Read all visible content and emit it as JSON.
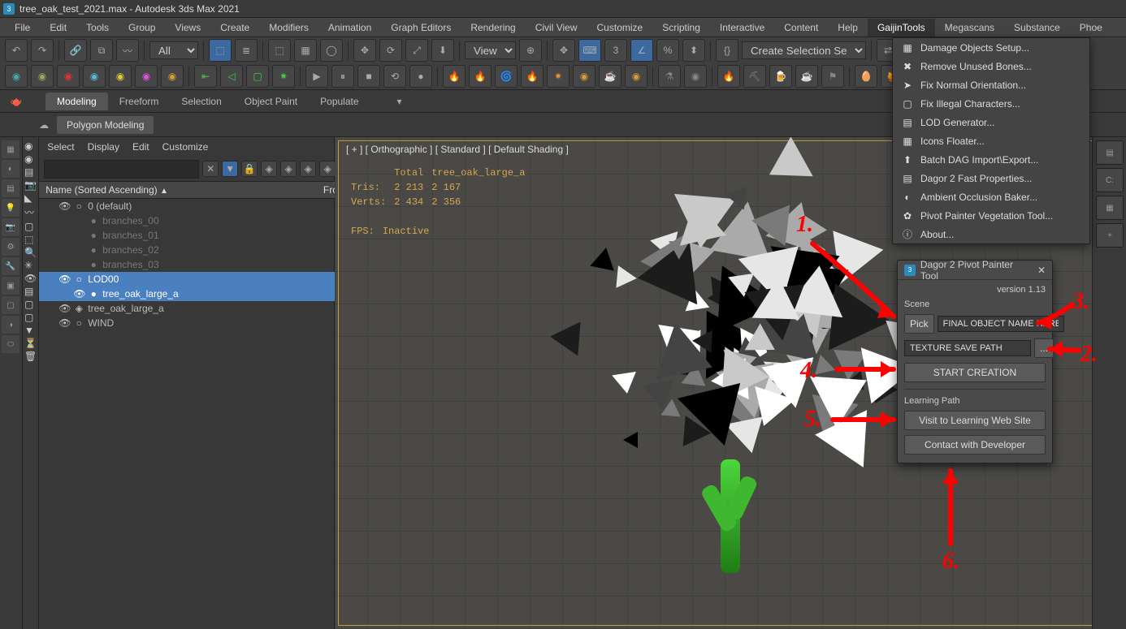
{
  "app": {
    "icon_label": "3",
    "title": "tree_oak_test_2021.max - Autodesk 3ds Max 2021"
  },
  "menu": [
    "File",
    "Edit",
    "Tools",
    "Group",
    "Views",
    "Create",
    "Modifiers",
    "Animation",
    "Graph Editors",
    "Rendering",
    "Civil View",
    "Customize",
    "Scripting",
    "Interactive",
    "Content",
    "Help",
    "GaijinTools",
    "Megascans",
    "Substance",
    "Phoe"
  ],
  "menu_active_index": 16,
  "toolbar": {
    "dd_all": "All",
    "dd_view": "View",
    "dd_selset": "Create Selection Se"
  },
  "ribbon": {
    "tabs": [
      "Modeling",
      "Freeform",
      "Selection",
      "Object Paint",
      "Populate"
    ],
    "active_index": 0,
    "sub_panel": "Polygon Modeling"
  },
  "explorer": {
    "menu": [
      "Select",
      "Display",
      "Edit",
      "Customize"
    ],
    "filter_placeholder": "",
    "header_name": "Name (Sorted Ascending)",
    "header_sort_arrow": "▲",
    "header_frozen": "Frozen",
    "rows": [
      {
        "indent": 0,
        "eye": "👁",
        "ico": "○",
        "text": "0 (default)",
        "ghost": false
      },
      {
        "indent": 1,
        "eye": "",
        "ico": "●",
        "text": "branches_00",
        "ghost": true
      },
      {
        "indent": 1,
        "eye": "",
        "ico": "●",
        "text": "branches_01",
        "ghost": true
      },
      {
        "indent": 1,
        "eye": "",
        "ico": "●",
        "text": "branches_02",
        "ghost": true
      },
      {
        "indent": 1,
        "eye": "",
        "ico": "●",
        "text": "branches_03",
        "ghost": true
      },
      {
        "indent": 0,
        "eye": "👁",
        "ico": "○",
        "text": "LOD00",
        "sel": true
      },
      {
        "indent": 1,
        "eye": "👁",
        "ico": "●",
        "text": "tree_oak_large_a",
        "sel": true
      },
      {
        "indent": 0,
        "eye": "👁",
        "ico": "◈",
        "text": "tree_oak_large_a"
      },
      {
        "indent": 0,
        "eye": "👁",
        "ico": "○",
        "text": "WIND"
      }
    ]
  },
  "viewport": {
    "label": "[ + ] [ Orthographic ] [ Standard ] [ Default Shading ]",
    "stats": {
      "col_total": "Total",
      "col_obj": "tree_oak_large_a",
      "tris_label": "Tris:",
      "tris_total": "2 213",
      "tris_obj": "2 167",
      "verts_label": "Verts:",
      "verts_total": "2 434",
      "verts_obj": "2 356",
      "fps_label": "FPS:",
      "fps_val": "Inactive"
    }
  },
  "dropdown": {
    "items": [
      {
        "ico": "▦",
        "label": "Damage Objects Setup..."
      },
      {
        "ico": "✖",
        "label": "Remove Unused Bones..."
      },
      {
        "ico": "➤",
        "label": "Fix Normal Orientation..."
      },
      {
        "ico": "▢",
        "label": "Fix Illegal Characters..."
      },
      {
        "ico": "▤",
        "label": "LOD Generator..."
      },
      {
        "ico": "▦",
        "label": "Icons Floater..."
      },
      {
        "ico": "⬆",
        "label": "Batch DAG Import\\Export..."
      },
      {
        "ico": "▤",
        "label": "Dagor 2 Fast Properties..."
      },
      {
        "ico": "◐",
        "label": "Ambient Occlusion Baker..."
      },
      {
        "ico": "✿",
        "label": "Pivot Painter Vegetation Tool..."
      },
      {
        "ico": "ⓘ",
        "label": "About..."
      }
    ]
  },
  "dialog": {
    "icon_label": "3",
    "title": "Dagor 2 Pivot Painter Tool",
    "close": "✕",
    "version": "version 1.13",
    "scene_label": "Scene",
    "pick_btn": "Pick",
    "obj_input": "FINAL OBJECT NAME HERE",
    "tex_input": "TEXTURE SAVE PATH",
    "browse_btn": "...",
    "start_btn": "START CREATION",
    "learning_label": "Learning Path",
    "visit_btn": "Visit to Learning Web Site",
    "contact_btn": "Contact with Developer"
  },
  "annotations": {
    "n1": "1.",
    "n2": "2.",
    "n3": "3.",
    "n4": "4.",
    "n5": "5.",
    "n6": "6."
  }
}
